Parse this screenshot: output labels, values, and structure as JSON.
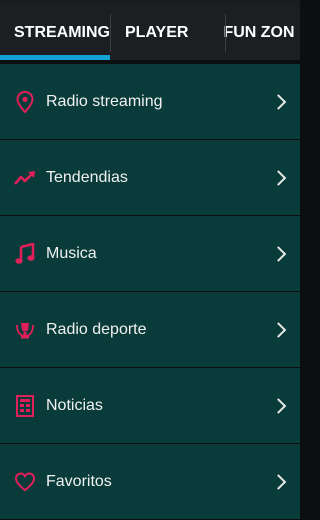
{
  "tabs": [
    {
      "label": "STREAMING",
      "active": true
    },
    {
      "label": "PLAYER",
      "active": false
    },
    {
      "label": "FUN ZON",
      "active": false
    }
  ],
  "menu": [
    {
      "label": "Radio streaming",
      "icon": "location-pin-icon"
    },
    {
      "label": "Tendendias",
      "icon": "trending-icon"
    },
    {
      "label": "Musica",
      "icon": "music-note-icon"
    },
    {
      "label": "Radio deporte",
      "icon": "trophy-icon"
    },
    {
      "label": "Noticias",
      "icon": "newspaper-icon"
    },
    {
      "label": "Favoritos",
      "icon": "heart-icon"
    }
  ],
  "colors": {
    "accent_tab": "#12a2d6",
    "icon": "#e0205a",
    "item_bg": "#083b39",
    "tabbar_bg": "#1c1f22"
  }
}
